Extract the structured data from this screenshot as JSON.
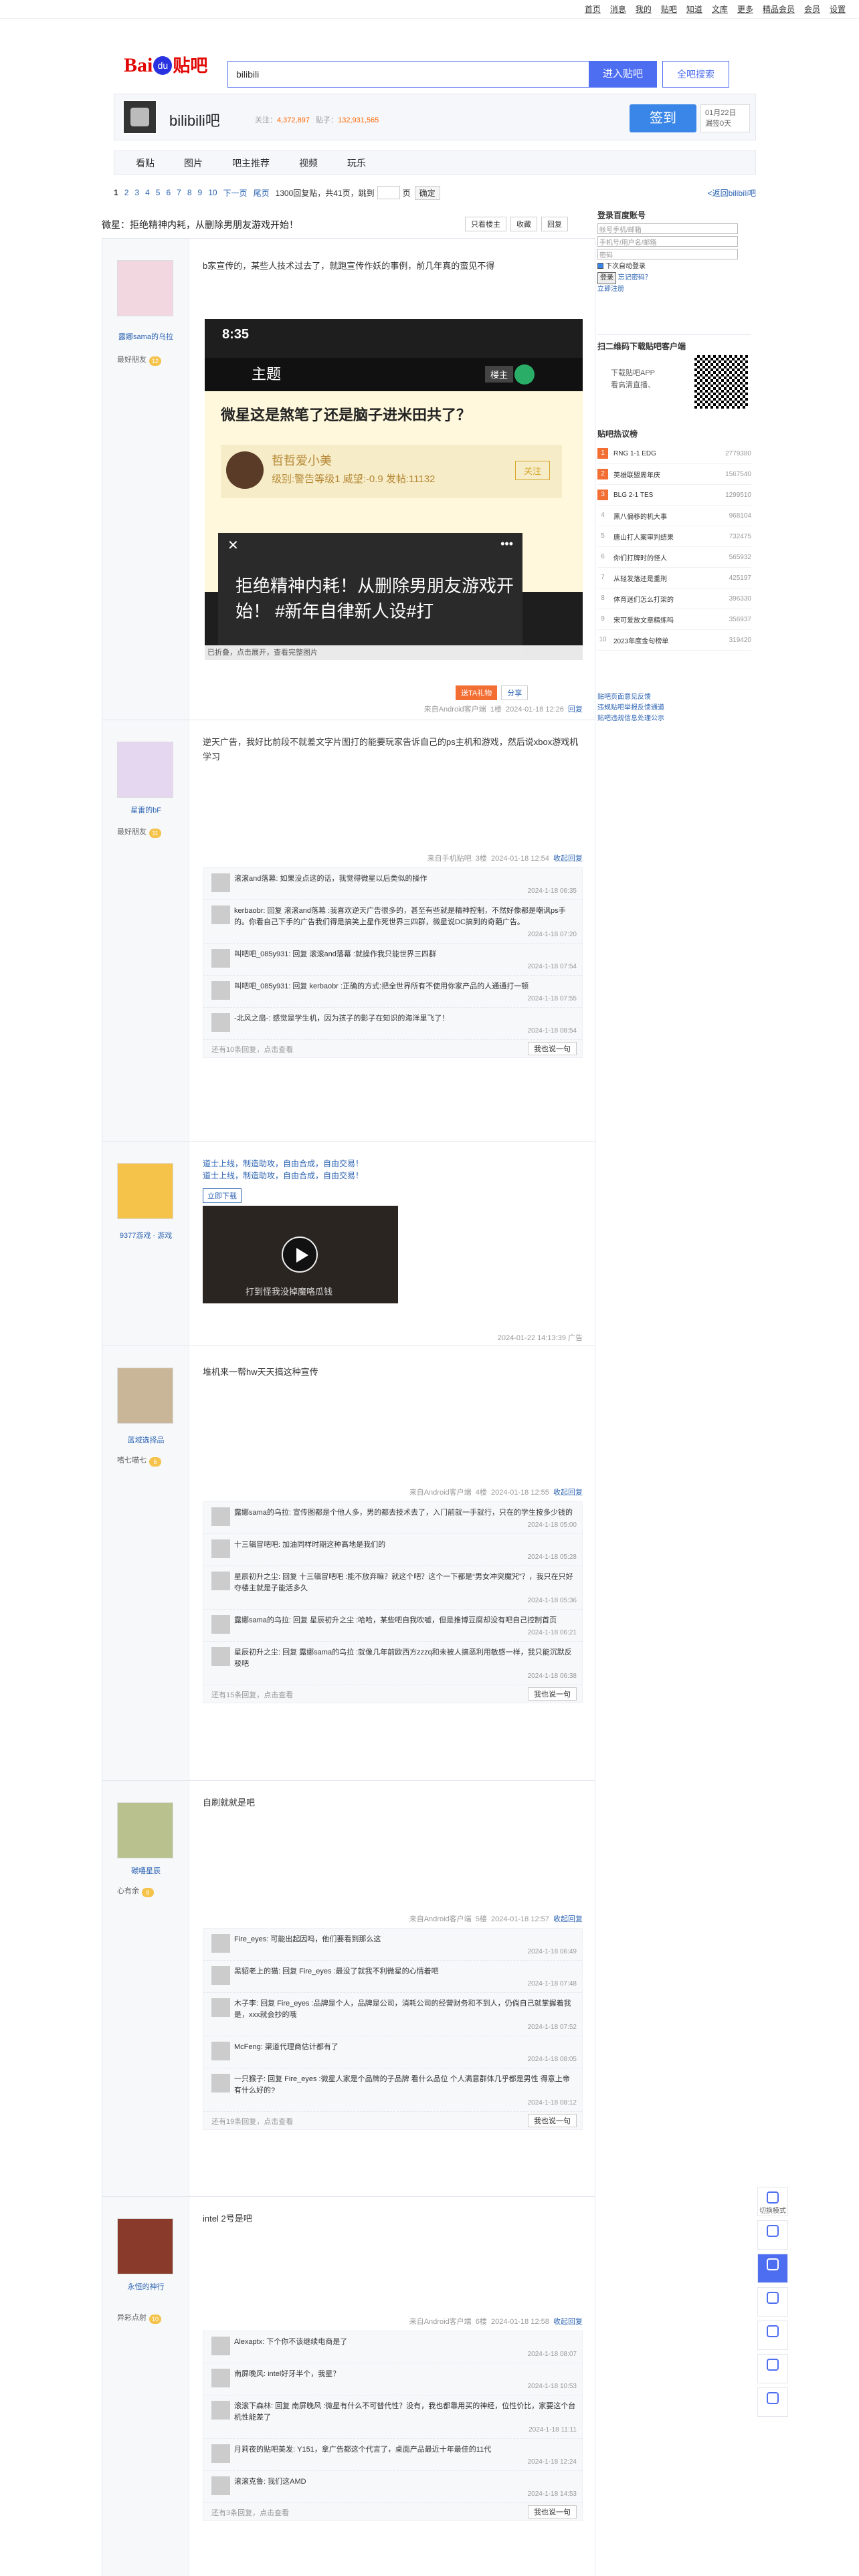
{
  "topbar": {
    "items": [
      "首页",
      "消息",
      "我的",
      "贴吧",
      "知道",
      "文库",
      "更多",
      "精品会员",
      "会员",
      "设置"
    ]
  },
  "header": {
    "logo_baidu": "Bai",
    "logo_du": "du",
    "logo_tieba": "贴吧",
    "search_value": "bilibili",
    "enter_btn": "进入贴吧",
    "global_btn": "全吧搜索"
  },
  "forum": {
    "name": "bilibili吧",
    "members_label": "关注：",
    "members": "4,372,897",
    "posts_label": "贴子：",
    "posts": "132,931,565",
    "sign_btn": "签到",
    "sign_date": "01月22日",
    "sign_days": "漏签0天"
  },
  "nav": {
    "tabs": [
      "看贴",
      "图片",
      "吧主推荐",
      "视频",
      "玩乐"
    ]
  },
  "pager": {
    "pages": [
      "1",
      "2",
      "3",
      "4",
      "5",
      "6",
      "7",
      "8",
      "9",
      "10"
    ],
    "next": "下一页",
    "last": "尾页",
    "summary": "1300回复贴，共41页，跳到",
    "unit": "页",
    "go": "确定",
    "back": "<返回bilibili吧"
  },
  "thread": {
    "title": "微星：拒绝精神内耗，从删除男朋友游戏开始！",
    "actions": [
      "只看楼主",
      "收藏",
      "回复"
    ]
  },
  "posts": [
    {
      "user": "露娜sama的乌拉",
      "level": "最好朋友",
      "level_num": "12",
      "text": "b家宣传的，某些人技术过去了，就跑宣传作妖的事例，前几年真的蛮见不得",
      "shot": {
        "time": "8:35",
        "nav_title": "主题",
        "lz_chip": "楼主",
        "question": "微星这是煞笔了还是脑子进米田共了？",
        "mini_name": "哲哲爱小美",
        "mini_level": "级别:警告等级1 威望:-0.9 发帖:11132",
        "follow": "关注",
        "dark_text": "拒绝精神内耗！从删除男朋友游戏开始！ #新年自律新人设#打",
        "expand": "已折叠，点击展开，查看完整图片"
      },
      "share_a": "送TA礼物",
      "share_b": "分享",
      "meta": {
        "device": "来自Android客户端",
        "floor": "1楼",
        "time": "2024-01-18 12:26",
        "reply": "回复"
      }
    },
    {
      "user": "星雷的bF",
      "level": "最好朋友",
      "level_num": "11",
      "text": "逆天广告，我好比前段不就差文字片图打的能要玩家告诉自己的ps主机和游戏，然后说xbox游戏机学习",
      "meta": {
        "device": "来自手机贴吧",
        "floor": "3楼",
        "time": "2024-01-18 12:54",
        "reply": "收起回复"
      },
      "replies": [
        {
          "text": "滚滚and落幕: 如果没点这的话，我觉得微星以后类似的操作",
          "time": "2024-1-18 06:35"
        },
        {
          "text": "kerbaobr: 回复 滚滚and落幕 :我喜欢逆天广告很多的，甚至有些就是精神控制，不然好像都是嘲讽ps手的。你看自己下手的广告我们得是搞笑上星作死世界三四群，微星说DC搞到的奇葩广告。",
          "time": "2024-1-18 07:20"
        },
        {
          "text": "叫吧吧_085y931: 回复 滚滚and落幕 :就操作我只能世界三四群",
          "time": "2024-1-18 07:54"
        },
        {
          "text": "叫吧吧_085y931: 回复 kerbaobr :正确的方式:把全世界所有不使用你家产品的人通通打一顿",
          "time": "2024-1-18 07:55"
        },
        {
          "text": "-北风之扇-: 感觉是学生机，因为孩子的影子在知识的海洋里飞了！",
          "time": "2024-1-18 08:54"
        }
      ],
      "foot": "还有10条回复，点击查看",
      "say": "我也说一句"
    },
    {
      "user": "9377游戏 · 游戏",
      "ad_line1": "道士上线，制造助攻，自由合成，自由交易！",
      "ad_line2": "道士上线，制造助攻，自由合成，自由交易！",
      "ad_btn": "立即下载",
      "video_cap": "打到怪我没掉魔咯瓜钱",
      "meta_time": "2024-01-22 14:13:39 广告"
    },
    {
      "user": "蓝域选择品",
      "level": "嗜七喵七",
      "level_num": "6",
      "text": "堆机来一帮hw天天搞这种宣传",
      "meta": {
        "device": "来自Android客户端",
        "floor": "4楼",
        "time": "2024-01-18 12:55",
        "reply": "收起回复"
      },
      "replies": [
        {
          "text": "露娜sama的乌拉: 宣传图都是个他人多，男的都去技术去了，入门前就一手就行，只在的学生按多少钱的",
          "time": "2024-1-18 05:00"
        },
        {
          "text": "十三辑冒吧吧: 加油同样时期这种高地是我们的",
          "time": "2024-1-18 05:28"
        },
        {
          "text": "星辰初升之尘: 回复 十三辑冒吧吧 :能不放弃嘛？就这个吧？这个一下都是“男女冲突魔咒”？，我只在只好夺楼主就是子能活多久",
          "time": "2024-1-18 05:36"
        },
        {
          "text": "露娜sama的乌拉: 回复 星辰初升之尘 :哈哈，某些吧自我吹嘘，但是推博豆腐却没有吧自己控制首页",
          "time": "2024-1-18 06:21"
        },
        {
          "text": "星辰初升之尘: 回复 露娜sama的乌拉 :就像几年前欧西方zzzq和未被人搞恶利用敏感一样，我只能沉默反驳吧",
          "time": "2024-1-18 06:38"
        }
      ],
      "foot": "还有15条回复，点击查看",
      "say": "我也说一句"
    },
    {
      "user": "碳嘻星辰",
      "level": "心有余",
      "level_num": "8",
      "text": "自刷就就是吧",
      "meta": {
        "device": "来自Android客户端",
        "floor": "5楼",
        "time": "2024-01-18 12:57",
        "reply": "收起回复"
      },
      "replies": [
        {
          "text": "Fire_eyes: 可能出起因吗，他们要看到那么这",
          "time": "2024-1-18 06:49"
        },
        {
          "text": "黑貂老上的猫: 回复 Fire_eyes :最没了就我不利微星的心情着吧",
          "time": "2024-1-18 07:48"
        },
        {
          "text": "木子李: 回复 Fire_eyes :品牌是个人，品牌是公司，消耗公司的经营财务和不到人，仍倘自己就掌握着我是，xxx就会抄的哦",
          "time": "2024-1-18 07:52"
        },
        {
          "text": "McFeng: 渠道代理商估计都有了",
          "time": "2024-1-18 08:05"
        },
        {
          "text": "一只猴子: 回复 Fire_eyes :微星人家是个品牌的子品牌 看什么品位 个人满意群体几乎都是男性 得意上帝有什么好的?",
          "time": "2024-1-18 08:12"
        }
      ],
      "foot": "还有19条回复，点击查看",
      "say": "我也说一句"
    },
    {
      "user": "永恒的神行",
      "level": "异彩点射",
      "level_num": "10",
      "text": "intel 2号是吧",
      "meta": {
        "device": "来自Android客户端",
        "floor": "6楼",
        "time": "2024-01-18 12:58",
        "reply": "收起回复"
      },
      "replies": [
        {
          "text": "Alexaptx: 下个你不该继续电商是了",
          "time": "2024-1-18 08:07"
        },
        {
          "text": "南屏晚风: intel好牙半个，我星？",
          "time": "2024-1-18 10:53"
        },
        {
          "text": "滚滚下森林: 回复 南屏晚风 :微星有什么不可替代性？没有，我也都靠用买的神经，位性价比，家要这个台机性能差了",
          "time": "2024-1-18 11:11"
        },
        {
          "text": "月莉夜的贴吧美发: Y151，拿广告都这个代言了，桌面产品最近十年最佳的11代",
          "time": "2024-1-18 12:24"
        },
        {
          "text": "滚滚克鲁: 我们这AMD",
          "time": "2024-1-18 14:53"
        }
      ],
      "foot": "还有3条回复，点击查看",
      "say": "我也说一句"
    }
  ],
  "sidebar": {
    "login": {
      "title": "登录百度账号",
      "user_ph": "帐号手机/邮箱",
      "pass_ph": "手机号/用户名/邮箱",
      "captcha_ph": "密码",
      "remember": "下次自动登录",
      "login_btn": "登录",
      "forgot": "忘记密码？",
      "register": "立即注册"
    },
    "app": {
      "title": "扫二维码下载贴吧客户端",
      "line1": "下载贴吧APP",
      "line2": "看高清直播、"
    },
    "rank_title": "贴吧热议榜",
    "rank": [
      {
        "n": "1",
        "name": "RNG 1-1 EDG",
        "v": "2779380"
      },
      {
        "n": "2",
        "name": "英雄联盟周年庆",
        "v": "1567540"
      },
      {
        "n": "3",
        "name": "BLG 2-1 TES",
        "v": "1299510"
      },
      {
        "n": "4",
        "name": "黑八偏移的机大事",
        "v": "968104"
      },
      {
        "n": "5",
        "name": "唐山打人案审判结果",
        "v": "732475"
      },
      {
        "n": "6",
        "name": "你们打牌时的怪人",
        "v": "565932"
      },
      {
        "n": "7",
        "name": "从轻发落还是重刑",
        "v": "425197"
      },
      {
        "n": "8",
        "name": "体育迷们怎么打架的",
        "v": "396330"
      },
      {
        "n": "9",
        "name": "宋可爱放文章精练吗",
        "v": "356937"
      },
      {
        "n": "10",
        "name": "2023年度金句榜单",
        "v": "319420"
      }
    ],
    "help": [
      "贴吧页面意见反馈",
      "违规贴吧举报反馈通道",
      "贴吧违规信息处理公示"
    ]
  },
  "tools": [
    "切换模式",
    "",
    "",
    "",
    "",
    "",
    ""
  ]
}
